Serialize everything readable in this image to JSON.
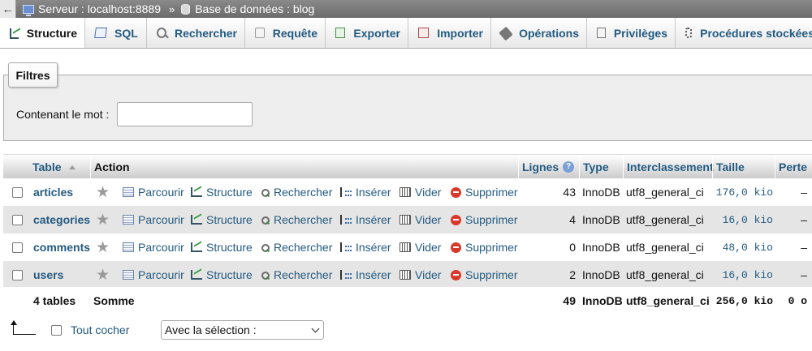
{
  "breadcrumb": {
    "back": "←",
    "server": "Serveur : localhost:8889",
    "separator": "»",
    "database": "Base de données : blog"
  },
  "tabs": [
    {
      "label": "Structure",
      "icon": "structure-icon",
      "active": true
    },
    {
      "label": "SQL",
      "icon": "sql-icon"
    },
    {
      "label": "Rechercher",
      "icon": "search-icon"
    },
    {
      "label": "Requête",
      "icon": "query-icon"
    },
    {
      "label": "Exporter",
      "icon": "export-icon"
    },
    {
      "label": "Importer",
      "icon": "import-icon"
    },
    {
      "label": "Opérations",
      "icon": "wrench-icon"
    },
    {
      "label": "Privilèges",
      "icon": "privileges-icon"
    },
    {
      "label": "Procédures stockées",
      "icon": "routines-icon"
    }
  ],
  "filters": {
    "legend": "Filtres",
    "label": "Contenant le mot :",
    "value": "",
    "placeholder": ""
  },
  "table": {
    "headers": {
      "table": "Table",
      "action": "Action",
      "rows": "Lignes",
      "type": "Type",
      "collation": "Interclassement",
      "size": "Taille",
      "overhead": "Perte"
    },
    "actions": {
      "browse": "Parcourir",
      "structure": "Structure",
      "search": "Rechercher",
      "insert": "Insérer",
      "empty": "Vider",
      "drop": "Supprimer"
    },
    "star": "★",
    "rows": [
      {
        "name": "articles",
        "rows": "43",
        "type": "InnoDB",
        "collation": "utf8_general_ci",
        "size": "176,0 kio",
        "overhead": "–"
      },
      {
        "name": "categories",
        "rows": "4",
        "type": "InnoDB",
        "collation": "utf8_general_ci",
        "size": "16,0 kio",
        "overhead": "–"
      },
      {
        "name": "comments",
        "rows": "0",
        "type": "InnoDB",
        "collation": "utf8_general_ci",
        "size": "48,0 kio",
        "overhead": "–"
      },
      {
        "name": "users",
        "rows": "2",
        "type": "InnoDB",
        "collation": "utf8_general_ci",
        "size": "16,0 kio",
        "overhead": "–"
      }
    ],
    "summary": {
      "count": "4 tables",
      "label": "Somme",
      "rows": "49",
      "type": "InnoDB",
      "collation": "utf8_general_ci",
      "size": "256,0 kio",
      "overhead": "0 o"
    }
  },
  "footer": {
    "check_all": "Tout cocher",
    "with_selected": "Avec la sélection :"
  }
}
